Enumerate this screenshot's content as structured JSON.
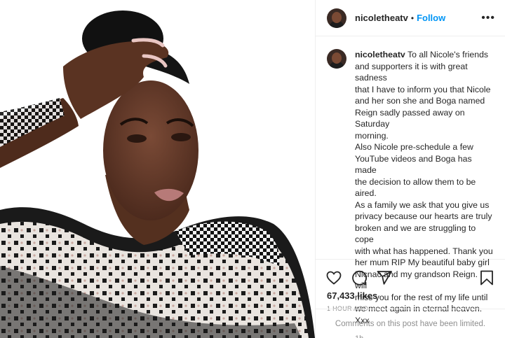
{
  "photo": {
    "alt": ""
  },
  "header": {
    "username": "nicoletheatv",
    "separator": "•",
    "follow_label": "Follow",
    "more_icon": "more-horizontal-icon"
  },
  "comment": {
    "username": "nicoletheatv",
    "lines": [
      "To all Nicole's friends",
      "and supporters it is with great sadness",
      "that I have to inform you that Nicole",
      "and her son she and Boga named",
      "Reign sadly passed away on Saturday",
      "morning.",
      "Also Nicole pre-schedule a few",
      "YouTube videos and Boga has made",
      "the decision to allow them to be aired.",
      "As a family we ask that you give us",
      "privacy because our hearts are truly",
      "broken and we are struggling to cope",
      "with what has happened. Thank you",
      "her mum RIP My beautiful baby girl",
      "Nicnac and my grandson Reign. I will",
      "miss you for the rest of my life until",
      "we meet again in eternal heaven. Xxx"
    ],
    "age": "1h"
  },
  "actions": {
    "like_icon": "heart-icon",
    "comment_icon": "comment-icon",
    "share_icon": "share-icon",
    "save_icon": "bookmark-icon"
  },
  "likes": "67,433 likes",
  "posted": "1 HOUR AGO",
  "comments_limited": "Comments on this post have been limited.",
  "colors": {
    "follow": "#0095f6",
    "muted": "#8e8e8e",
    "text": "#262626",
    "border": "#efefef"
  }
}
